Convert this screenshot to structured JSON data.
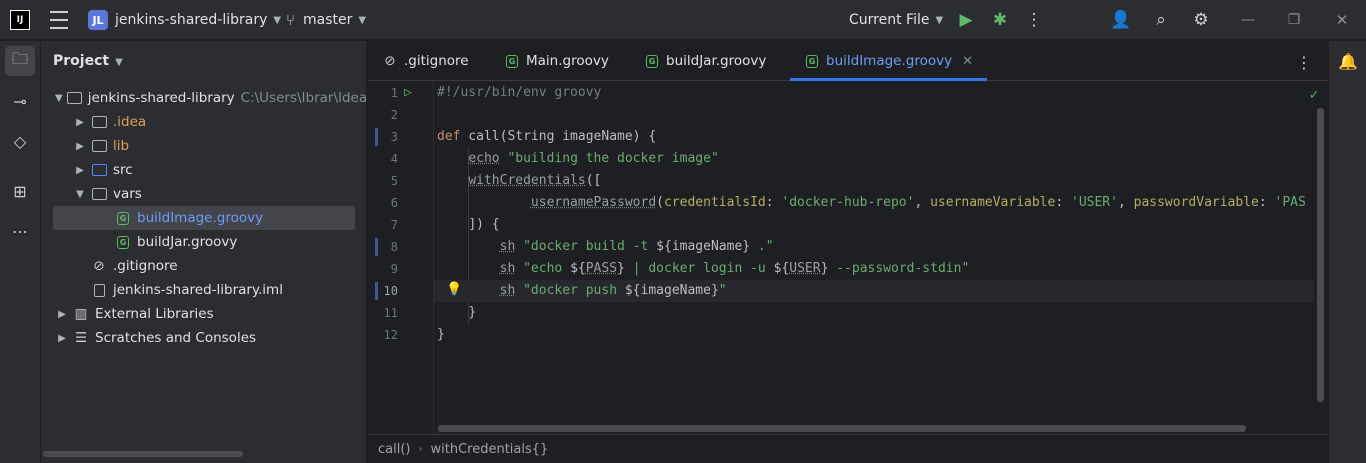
{
  "titlebar": {
    "logo": "IJ",
    "project_initials": "JL",
    "project_name": "jenkins-shared-library",
    "branch": "master",
    "run_config": "Current File",
    "colors": {
      "badge": "#5a78d9",
      "run": "#5fb865"
    }
  },
  "toolstrip": {
    "items": [
      "folder-icon",
      "commit-icon",
      "gitlab-icon",
      "structure-icon",
      "more-icon"
    ]
  },
  "project": {
    "title": "Project",
    "tree": [
      {
        "label": "jenkins-shared-library",
        "path": "C:\\Users\\Ibrar\\IdeaPr",
        "indent": 0,
        "expanded": true,
        "type": "module"
      },
      {
        "label": ".idea",
        "indent": 1,
        "expanded": false,
        "type": "folder-orange"
      },
      {
        "label": "lib",
        "indent": 1,
        "expanded": false,
        "type": "folder-orange"
      },
      {
        "label": "src",
        "indent": 1,
        "expanded": false,
        "type": "folder-blue"
      },
      {
        "label": "vars",
        "indent": 1,
        "expanded": true,
        "type": "folder"
      },
      {
        "label": "buildImage.groovy",
        "indent": 2,
        "type": "groovy",
        "selected": true
      },
      {
        "label": "buildJar.groovy",
        "indent": 2,
        "type": "groovy"
      },
      {
        "label": ".gitignore",
        "indent": 1,
        "type": "ignore"
      },
      {
        "label": "jenkins-shared-library.iml",
        "indent": 1,
        "type": "iml"
      },
      {
        "label": "External Libraries",
        "indent": 0,
        "expanded": false,
        "type": "libs"
      },
      {
        "label": "Scratches and Consoles",
        "indent": 0,
        "expanded": false,
        "type": "scratch"
      }
    ]
  },
  "tabs": [
    {
      "label": ".gitignore",
      "icon": "ignore-icon"
    },
    {
      "label": "Main.groovy",
      "icon": "groovy-icon"
    },
    {
      "label": "buildJar.groovy",
      "icon": "groovy-icon"
    },
    {
      "label": "buildImage.groovy",
      "icon": "groovy-icon",
      "active": true
    }
  ],
  "editor": {
    "line_numbers": [
      "1",
      "2",
      "3",
      "4",
      "5",
      "6",
      "7",
      "8",
      "9",
      "10",
      "11",
      "12"
    ],
    "current_line": "10",
    "code": {
      "l1": "#!/usr/bin/env groovy",
      "l3_kw": "def",
      "l3_rest": " call(String imageName) {",
      "l4_fn": "echo",
      "l4_str": " \"building the docker image\"",
      "l5_fn": "withCredentials",
      "l5_rest": "([",
      "l6_fn": "usernamePassword",
      "l6_p1": "(",
      "l6_n1": "credentialsId",
      "l6_s1": "'docker-hub-repo'",
      "l6_n2": "usernameVariable",
      "l6_s2": "'USER'",
      "l6_n3": "passwordVariable",
      "l6_s3": "'PAS",
      "l7": "]) {",
      "l8_fn": "sh",
      "l8_s1": " \"docker build -t ",
      "l8_v": "${imageName}",
      "l8_s2": " .\"",
      "l9_fn": "sh",
      "l9_s1": " \"echo ",
      "l9_v1": "${",
      "l9_v1n": "PASS",
      "l9_v1c": "}",
      "l9_s2": " | docker login -u ",
      "l9_v2": "${",
      "l9_v2n": "USER",
      "l9_v2c": "}",
      "l9_s3": " --password-stdin\"",
      "l10_fn": "sh",
      "l10_s1": " \"docker push ",
      "l10_v": "${imageName}",
      "l10_s2": "\"",
      "l11": "}",
      "l12": "}"
    }
  },
  "breadcrumb": {
    "items": [
      "call()",
      "withCredentials{}"
    ]
  }
}
